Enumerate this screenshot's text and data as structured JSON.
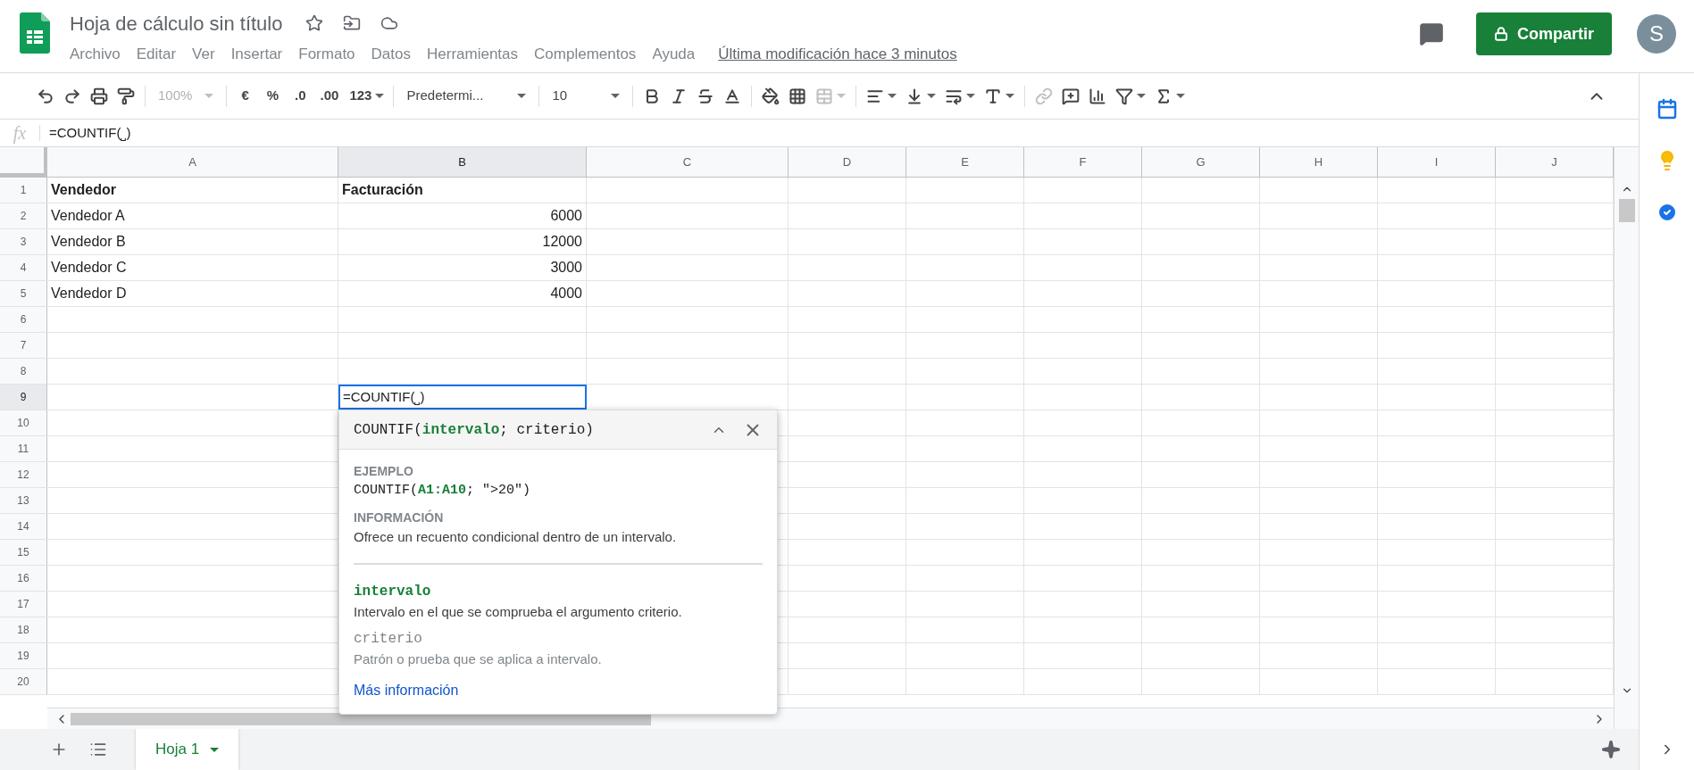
{
  "document": {
    "title": "Hoja de cálculo sin título",
    "last_modified": "Última modificación hace 3 minutos"
  },
  "menu": [
    "Archivo",
    "Editar",
    "Ver",
    "Insertar",
    "Formato",
    "Datos",
    "Herramientas",
    "Complementos",
    "Ayuda"
  ],
  "share_button": "Compartir",
  "avatar": "S",
  "toolbar": {
    "zoom": {
      "value": "100%",
      "disabled": true
    },
    "currency": "€",
    "percent": "%",
    "decrease_decimals": ".0",
    "increase_decimals": ".00",
    "number_format": "123",
    "font": "Predetermi...",
    "font_size": "10"
  },
  "formula_bar": {
    "label": "fx",
    "value": "=COUNTIF(⎵)"
  },
  "columns": [
    {
      "label": "A",
      "selected": false
    },
    {
      "label": "B",
      "selected": true
    },
    {
      "label": "C",
      "selected": false
    },
    {
      "label": "D",
      "selected": false
    },
    {
      "label": "E",
      "selected": false
    },
    {
      "label": "F",
      "selected": false
    },
    {
      "label": "G",
      "selected": false
    },
    {
      "label": "H",
      "selected": false
    },
    {
      "label": "I",
      "selected": false
    },
    {
      "label": "J",
      "selected": false
    }
  ],
  "rows": [
    {
      "number": "1",
      "selected": false,
      "cells": [
        {
          "kind": "heading",
          "text": "Vendedor"
        },
        {
          "kind": "heading",
          "text": "Facturación"
        }
      ]
    },
    {
      "number": "2",
      "selected": false,
      "cells": [
        {
          "kind": "text",
          "text": "Vendedor A"
        },
        {
          "kind": "number",
          "text": "6000"
        }
      ]
    },
    {
      "number": "3",
      "selected": false,
      "cells": [
        {
          "kind": "text",
          "text": "Vendedor B"
        },
        {
          "kind": "number",
          "text": "12000"
        }
      ]
    },
    {
      "number": "4",
      "selected": false,
      "cells": [
        {
          "kind": "text",
          "text": "Vendedor C"
        },
        {
          "kind": "number",
          "text": "3000"
        }
      ]
    },
    {
      "number": "5",
      "selected": false,
      "cells": [
        {
          "kind": "text",
          "text": "Vendedor D"
        },
        {
          "kind": "number",
          "text": "4000"
        }
      ]
    },
    {
      "number": "6",
      "selected": false,
      "cells": []
    },
    {
      "number": "7",
      "selected": false,
      "cells": []
    },
    {
      "number": "8",
      "selected": false,
      "cells": []
    },
    {
      "number": "9",
      "selected": true,
      "cells": [
        {
          "kind": "empty"
        },
        {
          "kind": "editing",
          "text": "=COUNTIF(⎵)"
        }
      ]
    },
    {
      "number": "10",
      "selected": false,
      "cells": []
    },
    {
      "number": "11",
      "selected": false,
      "cells": []
    },
    {
      "number": "12",
      "selected": false,
      "cells": []
    },
    {
      "number": "13",
      "selected": false,
      "cells": []
    },
    {
      "number": "14",
      "selected": false,
      "cells": []
    },
    {
      "number": "15",
      "selected": false,
      "cells": []
    },
    {
      "number": "16",
      "selected": false,
      "cells": []
    },
    {
      "number": "17",
      "selected": false,
      "cells": []
    },
    {
      "number": "18",
      "selected": false,
      "cells": []
    },
    {
      "number": "19",
      "selected": false,
      "cells": []
    },
    {
      "number": "20",
      "selected": false,
      "cells": []
    }
  ],
  "formula_help": {
    "signature": "COUNTIF(**intervalo**; criterio)",
    "example_heading": "EJEMPLO",
    "example": "COUNTIF(**A1:A10**; \">20\")",
    "info_heading": "INFORMACIÓN",
    "info": "Ofrece un recuento condicional dentro de un intervalo.",
    "arguments": [
      {
        "name": "intervalo",
        "description": "Intervalo en el que se comprueba el argumento criterio.",
        "selected": true
      },
      {
        "name": "criterio",
        "description": "Patrón o prueba que se aplica a intervalo.",
        "selected": false
      }
    ],
    "more_link": "Más información"
  },
  "sheets": [
    {
      "name": "Hoja 1",
      "selected": true
    }
  ]
}
